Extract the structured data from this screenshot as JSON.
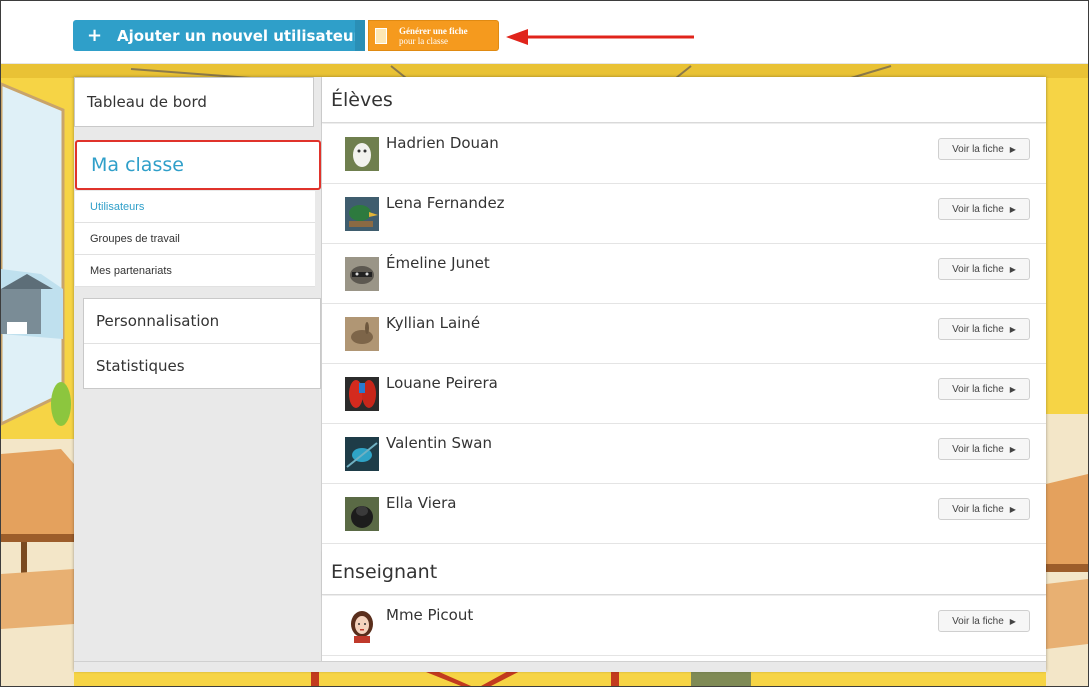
{
  "toolbar": {
    "add_user_label": "Ajouter un nouvel utilisateur",
    "generate_label_line1": "Générer une fiche",
    "generate_label_line2": "pour la classe"
  },
  "sidebar": {
    "dashboard": "Tableau de bord",
    "current_section": "Ma classe",
    "sub_items": [
      {
        "label": "Utilisateurs"
      },
      {
        "label": "Groupes de travail"
      },
      {
        "label": "Mes partenariats"
      }
    ],
    "lower_items": [
      {
        "label": "Personnalisation"
      },
      {
        "label": "Statistiques"
      }
    ]
  },
  "students": {
    "heading": "Élèves",
    "items": [
      {
        "name": "Hadrien Douan",
        "avatar": "snowy-owl-icon"
      },
      {
        "name": "Lena Fernandez",
        "avatar": "mallard-duck-icon"
      },
      {
        "name": "Émeline Junet",
        "avatar": "raccoon-icon"
      },
      {
        "name": "Kyllian Lainé",
        "avatar": "hare-icon"
      },
      {
        "name": "Louane Peirera",
        "avatar": "parrot-icon"
      },
      {
        "name": "Valentin Swan",
        "avatar": "kingfisher-icon"
      },
      {
        "name": "Ella Viera",
        "avatar": "gorilla-icon"
      }
    ]
  },
  "teachers": {
    "heading": "Enseignant",
    "items": [
      {
        "name": "Mme Picout",
        "avatar": "woman-avatar-icon"
      }
    ]
  },
  "actions": {
    "view_card": "Voir la fiche"
  },
  "colors": {
    "primary_blue": "#2f9fc9",
    "orange": "#f59a1e",
    "highlight_red": "#e0332b",
    "background_yellow": "#f7d542"
  }
}
